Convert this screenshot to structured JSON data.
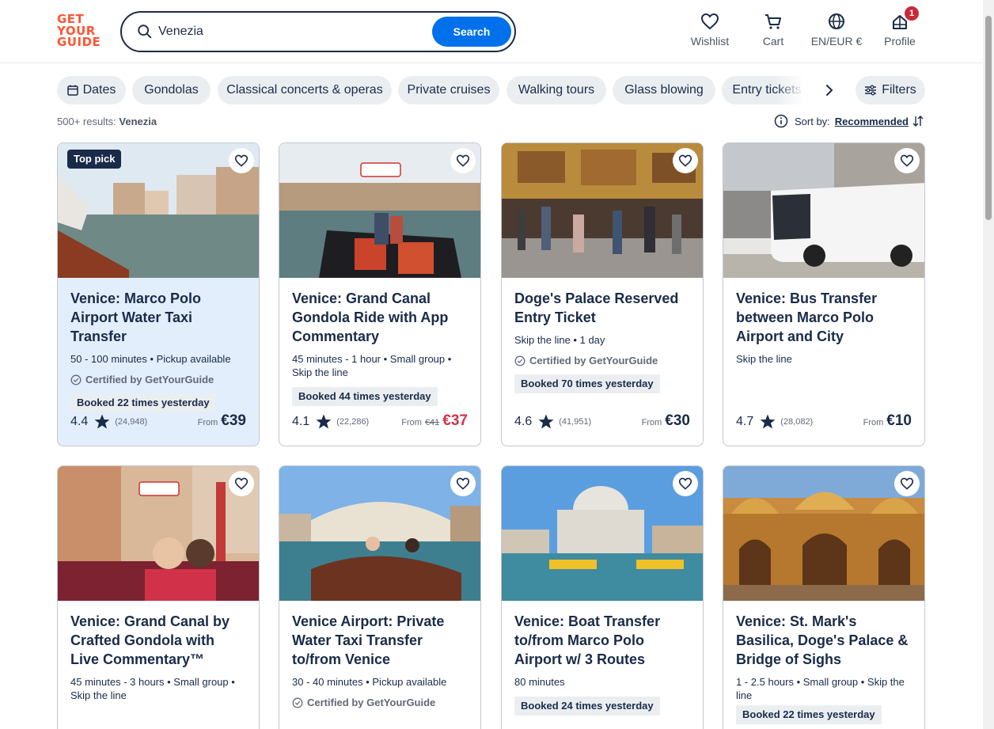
{
  "brand": {
    "logo_lines": [
      "GET",
      "YOUR",
      "GUIDE"
    ],
    "accent": "#ff5533",
    "primary": "#0071eb"
  },
  "search": {
    "value": "Venezia",
    "button": "Search"
  },
  "nav": {
    "wishlist": "Wishlist",
    "cart": "Cart",
    "language": "EN/EUR €",
    "profile": "Profile",
    "profile_badge": "1"
  },
  "chips": [
    "Dates",
    "Gondolas",
    "Classical concerts & operas",
    "Private cruises",
    "Walking tours",
    "Glass blowing",
    "Entry tickets"
  ],
  "filters_label": "Filters",
  "results": {
    "count": "500+ results:",
    "query": "Venezia"
  },
  "sort": {
    "label": "Sort by:",
    "value": "Recommended"
  },
  "cards": [
    {
      "title": "Venice: Marco Polo Airport Water Taxi Transfer",
      "meta": "50 - 100 minutes • Pickup available",
      "cert": "Certified by GetYourGuide",
      "booked": "Booked 22 times yesterday",
      "rating": "4.4",
      "reviews": "(24,948)",
      "from": "From",
      "old_price": "",
      "price": "€39",
      "badge": "Top pick"
    },
    {
      "title": "Venice: Grand Canal Gondola Ride with App Commentary",
      "meta": "45 minutes - 1 hour • Small group • Skip the line",
      "cert": "",
      "booked": "Booked 44 times yesterday",
      "rating": "4.1",
      "reviews": "(22,286)",
      "from": "From",
      "old_price": "€41",
      "price": "€37",
      "badge": ""
    },
    {
      "title": "Doge's Palace Reserved Entry Ticket",
      "meta": "Skip the line • 1 day",
      "cert": "Certified by GetYourGuide",
      "booked": "Booked 70 times yesterday",
      "rating": "4.6",
      "reviews": "(41,951)",
      "from": "From",
      "old_price": "",
      "price": "€30",
      "badge": ""
    },
    {
      "title": "Venice: Bus Transfer between Marco Polo Airport and City",
      "meta": "Skip the line",
      "cert": "",
      "booked": "",
      "rating": "4.7",
      "reviews": "(28,082)",
      "from": "From",
      "old_price": "",
      "price": "€10",
      "badge": ""
    },
    {
      "title": "Venice: Grand Canal by Crafted Gondola with Live Commentary™",
      "meta": "45 minutes - 3 hours • Small group • Skip the line",
      "cert": "",
      "booked": "",
      "rating": "",
      "reviews": "",
      "from": "",
      "old_price": "",
      "price": "",
      "badge": ""
    },
    {
      "title": "Venice Airport: Private Water Taxi Transfer to/from Venice",
      "meta": "30 - 40 minutes • Pickup available",
      "cert": "Certified by GetYourGuide",
      "booked": "",
      "rating": "",
      "reviews": "",
      "from": "",
      "old_price": "",
      "price": "",
      "badge": ""
    },
    {
      "title": "Venice: Boat Transfer to/from Marco Polo Airport w/ 3 Routes",
      "meta": "80 minutes",
      "cert": "",
      "booked": "Booked 24 times yesterday",
      "rating": "",
      "reviews": "",
      "from": "",
      "old_price": "",
      "price": "",
      "badge": ""
    },
    {
      "title": "Venice: St. Mark's Basilica, Doge's Palace & Bridge of Sighs",
      "meta": "1 - 2.5 hours • Small group • Skip the line",
      "cert": "",
      "booked": "Booked 22 times yesterday",
      "rating": "",
      "reviews": "",
      "from": "",
      "old_price": "",
      "price": "",
      "badge": ""
    }
  ],
  "card_images": [
    "water-taxi-canal-photo",
    "gondola-couple-photo",
    "doges-palace-hall-photo",
    "airport-bus-photo",
    "gondola-selfie-photo",
    "rialto-bridge-boat-photo",
    "salute-church-boats-photo",
    "st-marks-basilica-photo"
  ]
}
